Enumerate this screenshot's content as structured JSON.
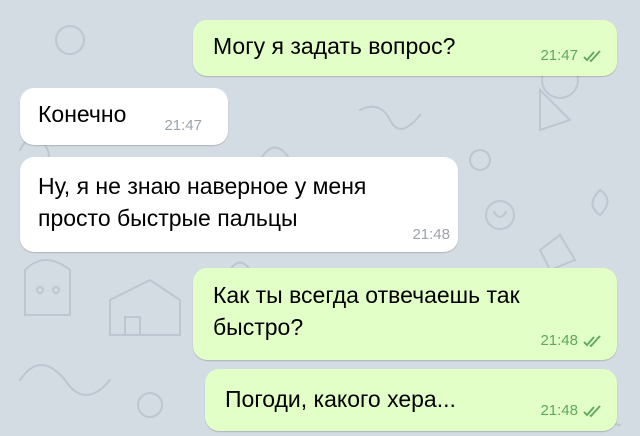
{
  "theme": {
    "incoming_bubble": "#ffffff",
    "outgoing_bubble": "#e1ffc7",
    "read_ticks": "#5fa85e",
    "wallpaper": "#d3dbe3"
  },
  "messages": [
    {
      "direction": "outgoing",
      "text": "Могу я задать вопрос?",
      "time": "21:47",
      "status_icon": "double-check-icon"
    },
    {
      "direction": "incoming",
      "text": "Конечно",
      "time": "21:47"
    },
    {
      "direction": "incoming",
      "text": "Ну, я не знаю наверное у меня\nпросто быстрые пальцы",
      "time": "21:48"
    },
    {
      "direction": "outgoing",
      "text": "Как ты всегда отвечаешь так\nбыстро?",
      "time": "21:48",
      "status_icon": "double-check-icon"
    },
    {
      "direction": "outgoing",
      "text": "Погоди, какого хера...",
      "time": "21:48",
      "status_icon": "double-check-icon"
    }
  ]
}
